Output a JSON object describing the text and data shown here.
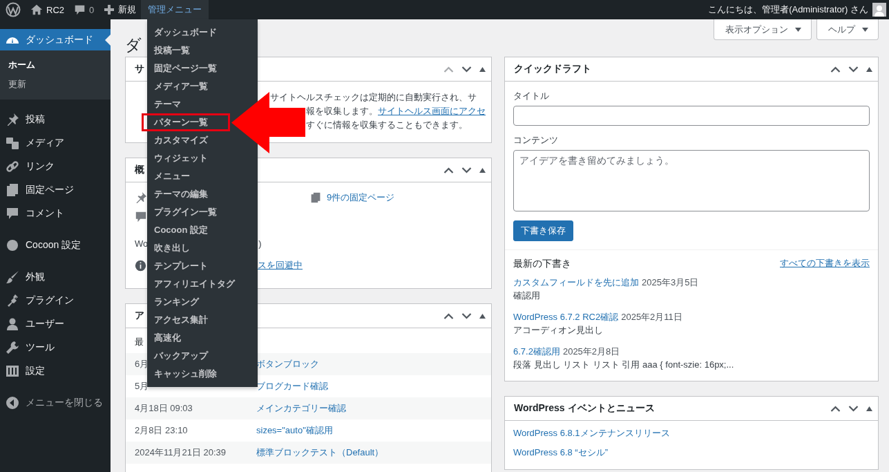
{
  "admin_bar": {
    "site_name": "RC2",
    "comment_count": "0",
    "new_label": "新規",
    "menu_label": "管理メニュー",
    "menu_open": true,
    "greeting": "こんにちは、管理者(Administrator) さん"
  },
  "admin_menu": {
    "items": [
      {
        "label": "ダッシュボード",
        "highlighted": false
      },
      {
        "label": "投稿一覧",
        "highlighted": false
      },
      {
        "label": "固定ページ一覧",
        "highlighted": false
      },
      {
        "label": "メディア一覧",
        "highlighted": false
      },
      {
        "label": "テーマ",
        "highlighted": false
      },
      {
        "label": "パターン一覧",
        "highlighted": true
      },
      {
        "label": "カスタマイズ",
        "highlighted": false
      },
      {
        "label": "ウィジェット",
        "highlighted": false
      },
      {
        "label": "メニュー",
        "highlighted": false
      },
      {
        "label": "テーマの編集",
        "highlighted": false
      },
      {
        "label": "プラグイン一覧",
        "highlighted": false
      },
      {
        "label": "Cocoon 設定",
        "highlighted": false
      },
      {
        "label": "吹き出し",
        "highlighted": false
      },
      {
        "label": "テンプレート",
        "highlighted": false
      },
      {
        "label": "アフィリエイトタグ",
        "highlighted": false
      },
      {
        "label": "ランキング",
        "highlighted": false
      },
      {
        "label": "アクセス集計",
        "highlighted": false
      },
      {
        "label": "高速化",
        "highlighted": false
      },
      {
        "label": "バックアップ",
        "highlighted": false
      },
      {
        "label": "キャッシュ削除",
        "highlighted": false
      }
    ]
  },
  "sidebar": {
    "sections": [
      {
        "items": [
          {
            "label": "ダッシュボード",
            "selected": true,
            "children": [
              {
                "label": "ホーム",
                "selected": true
              },
              {
                "label": "更新",
                "selected": false
              }
            ]
          }
        ]
      },
      {
        "items": [
          {
            "label": "投稿",
            "selected": false
          },
          {
            "label": "メディア",
            "selected": false
          },
          {
            "label": "リンク",
            "selected": false
          },
          {
            "label": "固定ページ",
            "selected": false
          },
          {
            "label": "コメント",
            "selected": false
          }
        ]
      },
      {
        "items": [
          {
            "label": "Cocoon 設定",
            "selected": false
          }
        ]
      },
      {
        "items": [
          {
            "label": "外観",
            "selected": false
          },
          {
            "label": "プラグイン",
            "selected": false
          },
          {
            "label": "ユーザー",
            "selected": false
          },
          {
            "label": "ツール",
            "selected": false
          },
          {
            "label": "設定",
            "selected": false
          }
        ]
      },
      {
        "items": [
          {
            "label": "メニューを閉じる",
            "selected": false
          }
        ]
      }
    ]
  },
  "screen_buttons": [
    "表示オプション",
    "ヘルプ"
  ],
  "page_title": "ダ",
  "site_health": {
    "title": "サ",
    "up_disabled": true,
    "lines": [
      {
        "text": "サイトヘルスチェックは定期的に自動実行され、サ"
      },
      {
        "text": "報を収集します。",
        "link": "サイトヘルス画面にアクセ"
      },
      {
        "text": "すぐに情報を収集することもできます。"
      }
    ]
  },
  "overview": {
    "title": "概",
    "up_disabled": false,
    "pages_link": "9件の固定ページ",
    "version_text": "Wo",
    "theme_text": ")",
    "notice_link": "スを回避中"
  },
  "activity": {
    "title": "ア",
    "up_disabled": false,
    "subheading": "最",
    "rows": [
      {
        "date": "6月",
        "title": "ボタンブロック"
      },
      {
        "date": "5月",
        "title": "ブログカード確認"
      },
      {
        "date": "4月18日 09:03",
        "title": "メインカテゴリー確認"
      },
      {
        "date": "2月8日 23:10",
        "title": "sizes=\"auto\"確認用"
      },
      {
        "date": "2024年11月21日 20:39",
        "title": "標準ブロックテスト（Default）"
      }
    ]
  },
  "quick_draft": {
    "title": "クイックドラフト",
    "up_disabled": false,
    "title_field": {
      "label": "タイトル"
    },
    "content_field": {
      "label": "コンテンツ",
      "placeholder": "アイデアを書き留めてみましょう。"
    },
    "save_button": "下書き保存",
    "drafts_heading": "最新の下書き",
    "view_all_link": "すべての下書きを表示",
    "drafts": [
      {
        "title": "カスタムフィールドを先に追加",
        "date": "2025年3月5日",
        "excerpt": "確認用"
      },
      {
        "title": "WordPress 6.7.2 RC2確認",
        "date": "2025年2月11日",
        "excerpt": "アコーディオン見出し"
      },
      {
        "title": "6.7.2確認用",
        "date": "2025年2月8日",
        "excerpt": "段落 見出し リスト リスト 引用 aaa { font-szie: 16px;..."
      }
    ]
  },
  "events": {
    "title": "WordPress イベントとニュース",
    "up_disabled": false,
    "links": [
      "WordPress 6.8.1メンテナンスリリース",
      "WordPress 6.8 “セシル”"
    ]
  }
}
